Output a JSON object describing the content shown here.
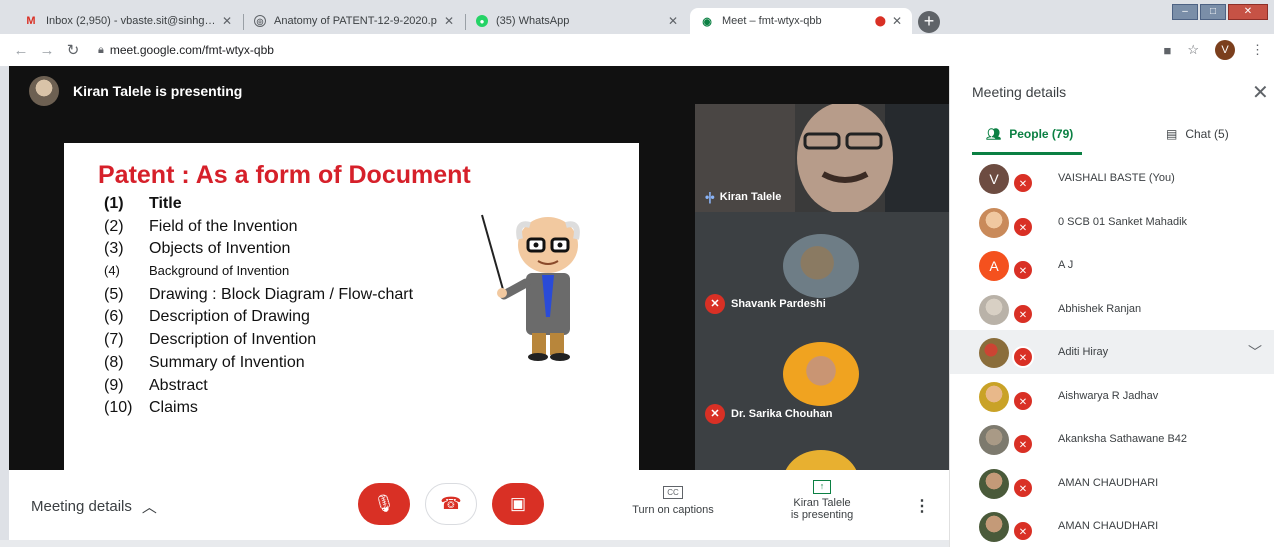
{
  "browser": {
    "tabs": [
      {
        "label": "Inbox (2,950) - vbaste.sit@sinhgad",
        "icon": "gmail-icon",
        "active": false
      },
      {
        "label": "Anatomy of PATENT-12-9-2020.p",
        "icon": "globe-icon",
        "active": false
      },
      {
        "label": "(35) WhatsApp",
        "icon": "whatsapp-icon",
        "active": false
      },
      {
        "label": "Meet – fmt-wtyx-qbb",
        "icon": "meet-icon",
        "active": true
      }
    ],
    "url": "meet.google.com/fmt-wtyx-qbb",
    "profile_initial": "V"
  },
  "stage": {
    "presenting_text": "Kiran Talele is presenting",
    "slide": {
      "title": "Patent  : As a form of Document",
      "items": [
        {
          "num": "(1)",
          "text": "Title",
          "style": "bold"
        },
        {
          "num": "(2)",
          "text": "Field of the Invention",
          "style": "normal"
        },
        {
          "num": "(3)",
          "text": "Objects of Invention",
          "style": "normal"
        },
        {
          "num": "(4)",
          "text": "Background of Invention",
          "style": "small"
        },
        {
          "num": "(5)",
          "text": "Drawing : Block  Diagram / Flow-chart",
          "style": "normal"
        },
        {
          "num": "(6)",
          "text": "Description of Drawing",
          "style": "normal"
        },
        {
          "num": "(7)",
          "text": "Description of Invention",
          "style": "normal"
        },
        {
          "num": "(8)",
          "text": "Summary of Invention",
          "style": "normal"
        },
        {
          "num": "(9)",
          "text": "Abstract",
          "style": "normal"
        },
        {
          "num": "(10)",
          "text": "Claims",
          "style": "normal"
        }
      ]
    },
    "tiles": [
      {
        "name": "Kiran Talele"
      },
      {
        "name": "Shavank Pardeshi"
      },
      {
        "name": "Dr. Sarika Chouhan"
      }
    ]
  },
  "controls": {
    "meeting_details": "Meeting details",
    "captions": "Turn on captions",
    "cc": "CC",
    "presenting_line1": "Kiran Talele",
    "presenting_line2": "is presenting"
  },
  "panel": {
    "title": "Meeting details",
    "people_tab": "People (79)",
    "chat_tab": "Chat (5)",
    "participants": [
      {
        "name": "VAISHALI BASTE (You)",
        "initial": "V",
        "color": "#6d4c41"
      },
      {
        "name": "0 SCB 01 Sanket Mahadik",
        "initial": "",
        "color": "#c98a5a"
      },
      {
        "name": "A J",
        "initial": "A",
        "color": "#f4511e"
      },
      {
        "name": "Abhishek Ranjan",
        "initial": "",
        "color": "#b9b2a8"
      },
      {
        "name": "Aditi Hiray",
        "initial": "",
        "color": "#8a6d3b"
      },
      {
        "name": "Aishwarya R Jadhav",
        "initial": "",
        "color": "#c9a227"
      },
      {
        "name": "Akanksha Sathawane B42",
        "initial": "",
        "color": "#7d7a6e"
      },
      {
        "name": "AMAN CHAUDHARI",
        "initial": "",
        "color": "#4a5a3a"
      },
      {
        "name": "AMAN CHAUDHARI",
        "initial": "",
        "color": "#4a5a3a"
      }
    ]
  },
  "colors": {
    "accent_green": "#0b8043",
    "mute_red": "#d93025",
    "slide_title_red": "#d6202a"
  }
}
